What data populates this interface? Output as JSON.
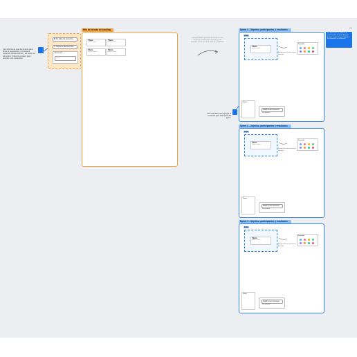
{
  "colors": {
    "canvas_bg": "#eceef1",
    "orange_accent": "#f4a340",
    "orange_fill": "#fde7c6",
    "blue_accent": "#2f80ed",
    "blue_title_bg": "#8ec1f5",
    "sticky_blue": "#1a73e8",
    "dot_colors": [
      "#4dabf7",
      "#f06595",
      "#fab005",
      "#51cf66",
      "#9775fa",
      "#ff922b",
      "#20c997",
      "#e64980"
    ]
  },
  "left_note": {
    "text": "Use la forma de este documento para llevar el seguimiento y controlar el contenido del documento y ver todos los elementos. Utilice los enlaces para acceder a los contenidos."
  },
  "blue_pin_icon": "pin-icon",
  "orange_panel": {
    "button1_label": "Ir a todos los elementos",
    "button2_label": "Tarjeta de Discovery Doc",
    "section_label": "Elementos",
    "input_placeholder": "Buscar"
  },
  "big_frame": {
    "title": "Hilo de la base de backlog",
    "cards": [
      {
        "title": "Título",
        "sub": "Texto o ícono"
      },
      {
        "title": "Título",
        "sub": "Texto o ícono"
      },
      {
        "title": "Título",
        "sub": "Texto o ícono"
      },
      {
        "title": "Título",
        "sub": "Texto o ícono"
      }
    ]
  },
  "middle_note": {
    "text": "Agregue aquí ejemplos de texto en una línea con el formato correcto y que muestre cómo se ve el texto en el tablero."
  },
  "mid_note2": {
    "text": "Use cada fase para agregar el contenido para cada paso del sprint."
  },
  "sticky": {
    "text": "Los elementos se pueden ver como tarjetas de texto. Agregue tarjetas a cada fila para organizar los elementos en columnas."
  },
  "sprint_frames": [
    {
      "title": "Sprint 1 - Objetivo, participantes y resultados",
      "tag": "Lista",
      "card_title": "Título",
      "card_sub": "Texto o ícono",
      "annotation": "Agregue todos los elementos de texto aquí",
      "legend_title": "Leyenda",
      "small_card_title": "Tarea",
      "btn1": "Añadir nuevo elemento",
      "btn2": "Documento"
    },
    {
      "title": "Sprint 2 - Objetivo, participantes y resultados",
      "tag": "Lista",
      "card_title": "Título",
      "card_sub": "Texto o ícono",
      "annotation": "Agregue todos los elementos de texto aquí",
      "legend_title": "Leyenda",
      "small_card_title": "Tarea",
      "btn1": "Añadir nuevo elemento",
      "btn2": "Documento"
    },
    {
      "title": "Sprint 3 - Objetivo, participantes y resultados",
      "tag": "Lista",
      "card_title": "Título",
      "card_sub": "Texto o ícono",
      "annotation": "Agregue todos los elementos de texto aquí",
      "legend_title": "Leyenda",
      "small_card_title": "Tarea",
      "btn1": "Añadir nuevo elemento",
      "btn2": "Documento"
    }
  ]
}
